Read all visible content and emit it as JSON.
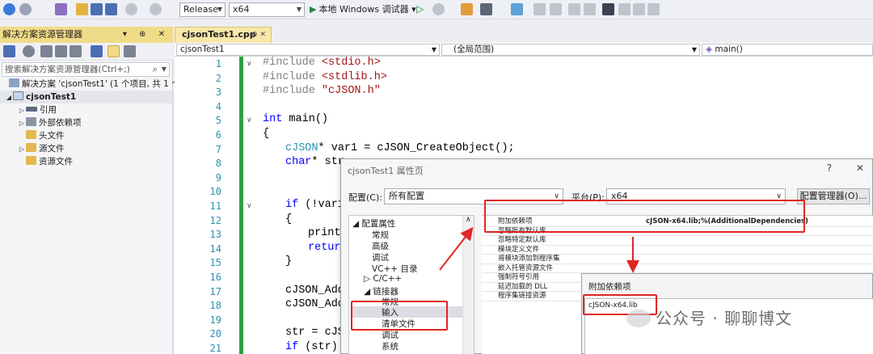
{
  "toolbar": {
    "configuration": "Release",
    "platform": "x64",
    "run_label": "本地 Windows 调试器"
  },
  "solution_explorer": {
    "title": "解决方案资源管理器",
    "search_placeholder": "搜索解决方案资源管理器(Ctrl+;)",
    "tree": [
      {
        "label": "解决方案 'cjsonTest1' (1 个项目, 共 1 个",
        "indent": 0
      },
      {
        "label": "cjsonTest1",
        "indent": 1
      },
      {
        "label": "引用",
        "indent": 2
      },
      {
        "label": "外部依赖项",
        "indent": 2
      },
      {
        "label": "头文件",
        "indent": 2
      },
      {
        "label": "源文件",
        "indent": 2
      },
      {
        "label": "资源文件",
        "indent": 2
      }
    ]
  },
  "editor": {
    "tab": "cjsonTest1.cpp",
    "nav_project": "cjsonTest1",
    "nav_scope": "(全局范围)",
    "nav_function": "main()",
    "line_numbers": [
      "1",
      "2",
      "3",
      "4",
      "5",
      "6",
      "7",
      "8",
      "9",
      "10",
      "11",
      "12",
      "13",
      "14",
      "15",
      "16",
      "17",
      "18",
      "19",
      "20",
      "21"
    ],
    "code": {
      "l1a": "#include ",
      "l1b": "<stdio.h>",
      "l2a": "#include ",
      "l2b": "<stdlib.h>",
      "l3a": "#include ",
      "l3b": "\"cJSON.h\"",
      "l5a": "int",
      "l5b": " main()",
      "l6": "{",
      "l7a": "cJSON",
      "l7b": "* var1 = cJSON_CreateObject();",
      "l8a": "char",
      "l8b": "* str",
      "l11a": "if",
      "l11b": " (!var1)",
      "l12": "{",
      "l13": "printf",
      "l14": "return",
      "l15": "}",
      "l17": "cJSON_AddS",
      "l18": "cJSON_AddS",
      "l20": "str = cJSO",
      "l21a": "if",
      "l21b": " (str)"
    }
  },
  "dialog": {
    "title": "cjsonTest1 属性页",
    "help": "?",
    "close": "✕",
    "config_label": "配置(C):",
    "config_value": "所有配置",
    "platform_label": "平台(P):",
    "platform_value": "x64",
    "config_manager": "配置管理器(O)...",
    "tree": {
      "root": "配置属性",
      "general": "常规",
      "advanced": "高级",
      "debugging": "调试",
      "vcdirs": "VC++ 目录",
      "cpp": "C/C++",
      "linker": "链接器",
      "linker_general": "常规",
      "linker_input": "输入",
      "manifest": "清单文件",
      "linker_debug": "调试",
      "system": "系统"
    },
    "properties": [
      {
        "name": "附加依赖项",
        "value": "cJSON-x64.lib;%(AdditionalDependencies)"
      },
      {
        "name": "忽略所有默认库",
        "value": ""
      },
      {
        "name": "忽略特定默认库",
        "value": ""
      },
      {
        "name": "模块定义文件",
        "value": ""
      },
      {
        "name": "将模块添加到程序集",
        "value": ""
      },
      {
        "name": "嵌入托管资源文件",
        "value": ""
      },
      {
        "name": "强制符号引用",
        "value": ""
      },
      {
        "name": "延迟加载的 DLL",
        "value": ""
      },
      {
        "name": "程序集链接资源",
        "value": ""
      }
    ]
  },
  "inner_dialog": {
    "title": "附加依赖项",
    "text": "cJSON-x64.lib"
  },
  "watermark": "公众号 · 聊聊博文",
  "colors": {
    "accent_red": "#e02525",
    "tab_yellow": "#f7e7a8",
    "change_green": "#2ea043"
  }
}
